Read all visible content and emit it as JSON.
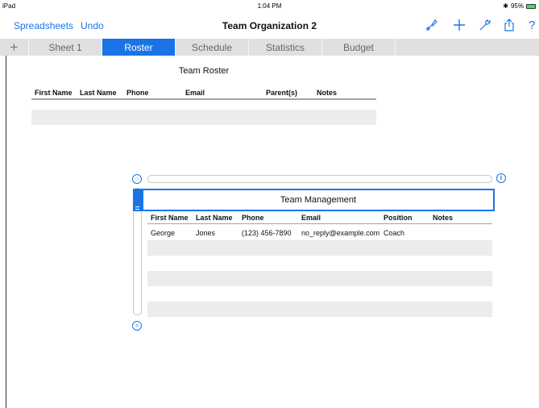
{
  "status": {
    "device": "iPad",
    "time": "1:04 PM",
    "battery": "95%"
  },
  "navbar": {
    "spreadsheets": "Spreadsheets",
    "undo": "Undo",
    "title": "Team Organization 2",
    "icons": [
      "brush-icon",
      "plus-icon",
      "wrench-icon",
      "share-icon",
      "help-icon"
    ],
    "help": "?"
  },
  "tabs": {
    "add": "+",
    "items": [
      {
        "label": "Sheet 1"
      },
      {
        "label": "Roster"
      },
      {
        "label": "Schedule"
      },
      {
        "label": "Statistics"
      },
      {
        "label": "Budget"
      }
    ],
    "active_index": 1
  },
  "roster_table": {
    "title": "Team Roster",
    "headers": [
      "First Name",
      "Last Name",
      "Phone",
      "Email",
      "Parent(s)",
      "Notes"
    ]
  },
  "management_table": {
    "title": "Team Management",
    "headers": [
      "First Name",
      "Last Name",
      "Phone",
      "Email",
      "Position",
      "Notes"
    ],
    "rows": [
      [
        "George",
        "Jones",
        "(123) 456-7890",
        "no_reply@example.com",
        "Coach",
        ""
      ]
    ]
  },
  "colors": {
    "accent": "#1a74e8",
    "tab_bg": "#e0e0e0",
    "row_shade": "#ececec"
  }
}
